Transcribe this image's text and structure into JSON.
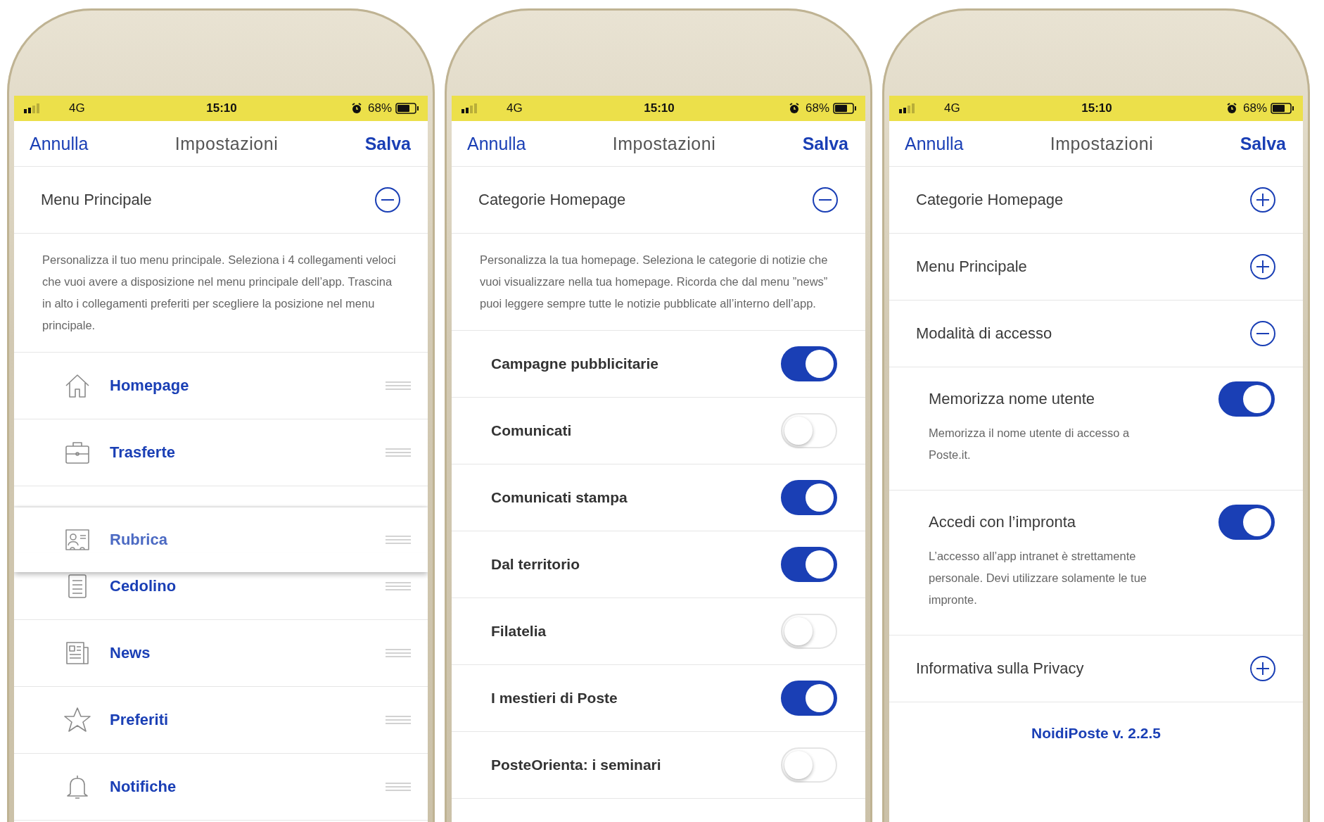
{
  "phones": [
    {
      "status_bar": {
        "network": "4G",
        "time": "15:10",
        "battery": "68%"
      },
      "nav": {
        "cancel": "Annulla",
        "title": "Impostazioni",
        "save": "Salva"
      },
      "sections": [
        {
          "title": "Menu Principale",
          "expanded": true,
          "description": "Personalizza il tuo menu principale. Seleziona i 4 collegamenti veloci che vuoi avere a disposizione nel menu principale dell’app. Trascina in alto i collegamenti preferiti per scegliere la posizione nel menu principale.",
          "items": [
            {
              "kind": "link",
              "label": "Homepage",
              "dragging": false
            },
            {
              "kind": "link",
              "label": "Trasferte",
              "dragging": false
            },
            {
              "kind": "link",
              "label": "Rubrica",
              "dragging": true
            },
            {
              "kind": "link",
              "label": "Cedolino",
              "dragging": false
            },
            {
              "kind": "link",
              "label": "News",
              "dragging": false
            },
            {
              "kind": "link",
              "label": "Preferiti",
              "dragging": false
            },
            {
              "kind": "link",
              "label": "Notifiche",
              "dragging": false
            }
          ]
        }
      ]
    },
    {
      "status_bar": {
        "network": "4G",
        "time": "15:10",
        "battery": "68%"
      },
      "nav": {
        "cancel": "Annulla",
        "title": "Impostazioni",
        "save": "Salva"
      },
      "sections": [
        {
          "title": "Categorie Homepage",
          "expanded": true,
          "description": "Personalizza la tua homepage. Seleziona le categorie di notizie che vuoi visualizzare nella tua homepage. Ricorda che dal menu ”news” puoi leggere sempre tutte le notizie pubblicate all’interno dell’app.",
          "items": [
            {
              "kind": "toggle",
              "label": "Campagne pubblicitarie",
              "on": true
            },
            {
              "kind": "toggle",
              "label": "Comunicati",
              "on": false
            },
            {
              "kind": "toggle",
              "label": "Comunicati stampa",
              "on": true
            },
            {
              "kind": "toggle",
              "label": "Dal territorio",
              "on": true
            },
            {
              "kind": "toggle",
              "label": "Filatelia",
              "on": false
            },
            {
              "kind": "toggle",
              "label": "I mestieri di Poste",
              "on": true
            },
            {
              "kind": "toggle",
              "label": "PosteOrienta: i seminari",
              "on": false
            }
          ]
        }
      ]
    },
    {
      "status_bar": {
        "network": "4G",
        "time": "15:10",
        "battery": "68%"
      },
      "nav": {
        "cancel": "Annulla",
        "title": "Impostazioni",
        "save": "Salva"
      },
      "sections": [
        {
          "title": "Categorie Homepage",
          "expanded": false
        },
        {
          "title": "Menu Principale",
          "expanded": false
        },
        {
          "title": "Modalità di accesso",
          "expanded": true,
          "items": [
            {
              "kind": "toggle-detail",
              "label": "Memorizza nome utente",
              "on": true,
              "description": "Memorizza il nome utente di accesso a Poste.it."
            },
            {
              "kind": "toggle-detail",
              "label": "Accedi con l’impronta",
              "on": true,
              "description": "L’accesso all’app intranet è strettamente personale. Devi utilizzare solamente le tue impronte."
            }
          ]
        },
        {
          "title": "Informativa sulla Privacy",
          "expanded": false
        }
      ],
      "footer": "NoidiPoste v. 2.2.5"
    }
  ]
}
